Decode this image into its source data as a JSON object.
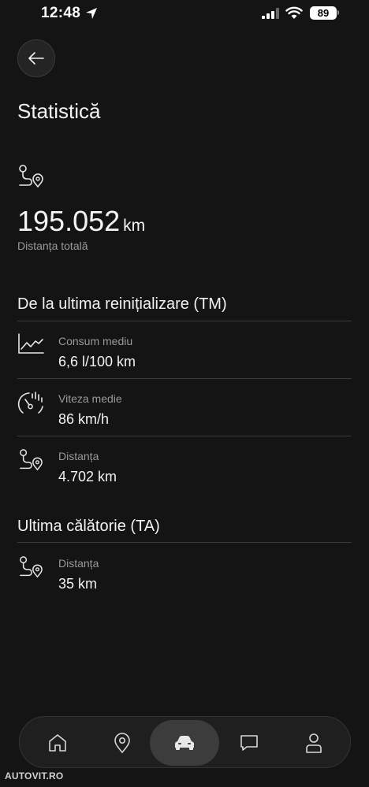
{
  "status_bar": {
    "time": "12:48",
    "battery": "89"
  },
  "page": {
    "title": "Statistică"
  },
  "total": {
    "value": "195.052",
    "unit": "km",
    "label": "Distanța totală"
  },
  "section_tm": {
    "title": "De la ultima reinițializare (TM)",
    "items": [
      {
        "icon": "chart-icon",
        "label": "Consum mediu",
        "value": "6,6 l/100 km"
      },
      {
        "icon": "speedometer-icon",
        "label": "Viteza medie",
        "value": "86 km/h"
      },
      {
        "icon": "route-icon",
        "label": "Distanța",
        "value": "4.702 km"
      }
    ]
  },
  "section_ta": {
    "title": "Ultima călătorie (TA)",
    "items": [
      {
        "icon": "route-icon",
        "label": "Distanța",
        "value": "35 km"
      }
    ]
  },
  "nav": {
    "items": [
      "home-icon",
      "location-pin-icon",
      "car-icon",
      "chat-icon",
      "profile-icon"
    ],
    "active": "car-icon"
  },
  "watermark": "AUTOVIT.RO",
  "colors": {
    "background": "#141414",
    "text": "#f2f2f2",
    "muted": "#9a9a9a",
    "divider": "#3a3a3a"
  }
}
